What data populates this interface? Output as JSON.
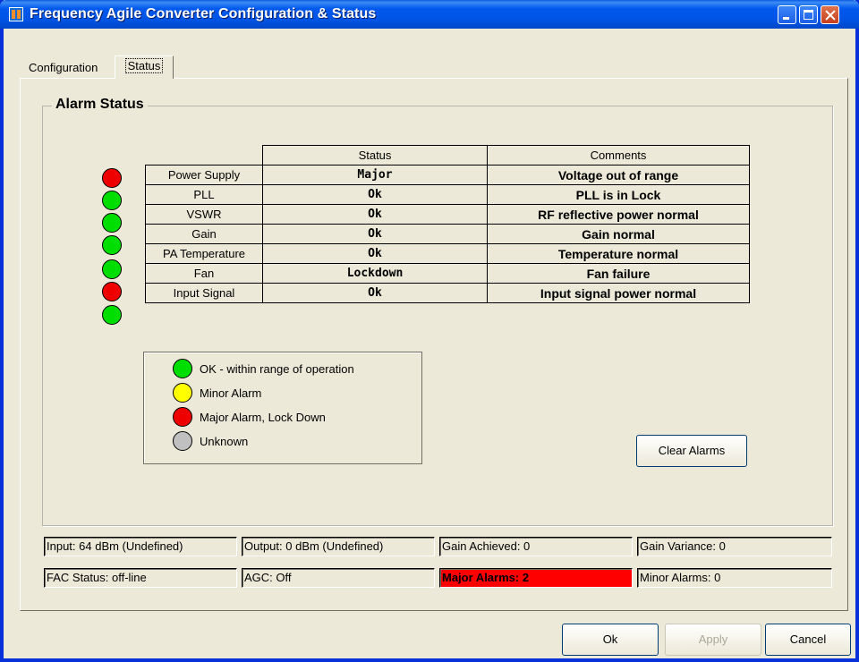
{
  "window": {
    "title": "Frequency Agile Converter Configuration & Status"
  },
  "tabs": [
    {
      "label": "Configuration",
      "active": false
    },
    {
      "label": "Status",
      "active": true
    }
  ],
  "alarm_group": {
    "title": "Alarm Status",
    "headers": {
      "status": "Status",
      "comments": "Comments"
    },
    "rows": [
      {
        "name": "Power Supply",
        "status": "Major",
        "comment": "Voltage out of range",
        "led": "red"
      },
      {
        "name": "PLL",
        "status": "Ok",
        "comment": "PLL is in Lock",
        "led": "green"
      },
      {
        "name": "VSWR",
        "status": "Ok",
        "comment": "RF reflective power normal",
        "led": "green"
      },
      {
        "name": "Gain",
        "status": "Ok",
        "comment": "Gain normal",
        "led": "green"
      },
      {
        "name": "PA Temperature",
        "status": "Ok",
        "comment": "Temperature normal",
        "led": "green"
      },
      {
        "name": "Fan",
        "status": "Lockdown",
        "comment": "Fan failure",
        "led": "red"
      },
      {
        "name": "Input Signal",
        "status": "Ok",
        "comment": "Input signal power normal",
        "led": "green"
      }
    ]
  },
  "legend": [
    {
      "label": "OK - within range of operation",
      "color": "green"
    },
    {
      "label": "Minor Alarm",
      "color": "yellow"
    },
    {
      "label": "Major Alarm, Lock Down",
      "color": "red"
    },
    {
      "label": "Unknown",
      "color": "gray"
    }
  ],
  "colors": {
    "green": "#00dd00",
    "red": "#ee0000",
    "yellow": "#ffff00",
    "gray": "#c0c0c0",
    "title_bar": "#0054e3",
    "major_alarm_bg": "#ff0000"
  },
  "buttons": {
    "clear_alarms": "Clear Alarms",
    "ok": "Ok",
    "apply": "Apply",
    "cancel": "Cancel"
  },
  "status_fields": {
    "input": "Input: 64 dBm (Undefined)",
    "output": "Output: 0 dBm (Undefined)",
    "gain_achieved": "Gain Achieved: 0",
    "gain_variance": "Gain Variance: 0",
    "fac_status": "FAC Status: off-line",
    "agc": "AGC: Off",
    "major_alarms": "Major Alarms: 2",
    "minor_alarms": "Minor Alarms: 0"
  }
}
